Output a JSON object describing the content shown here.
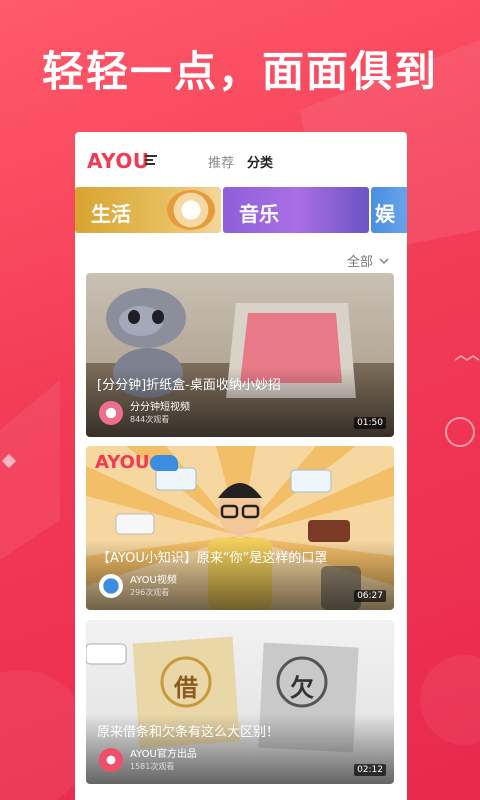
{
  "headline": "轻轻一点，面面俱到",
  "app": {
    "logo": "AYOU",
    "tabs": [
      {
        "label": "推荐",
        "active": false
      },
      {
        "label": "分类",
        "active": true
      }
    ]
  },
  "categories": [
    {
      "label": "生活"
    },
    {
      "label": "音乐"
    },
    {
      "label": "娱"
    }
  ],
  "filter": {
    "label": "全部",
    "icon": "chevron-down-icon"
  },
  "videos": [
    {
      "title": "[分分钟]折纸盒-桌面收纳小妙招",
      "author": "分分钟短视频",
      "views": "844次观看",
      "duration": "01:50"
    },
    {
      "title": "【AYOU小知识】原来“你”是这样的口罩",
      "author": "AYOU视频",
      "views": "296次观看",
      "duration": "06:27",
      "watermark": "AYOU"
    },
    {
      "title": "原来借条和欠条有这么大区别！",
      "author": "AYOU官方出品",
      "views": "1581次观看",
      "duration": "02:12",
      "labels": [
        "借",
        "欠"
      ]
    }
  ],
  "colors": {
    "brand": "#f23a55",
    "background": "#ee3350"
  }
}
